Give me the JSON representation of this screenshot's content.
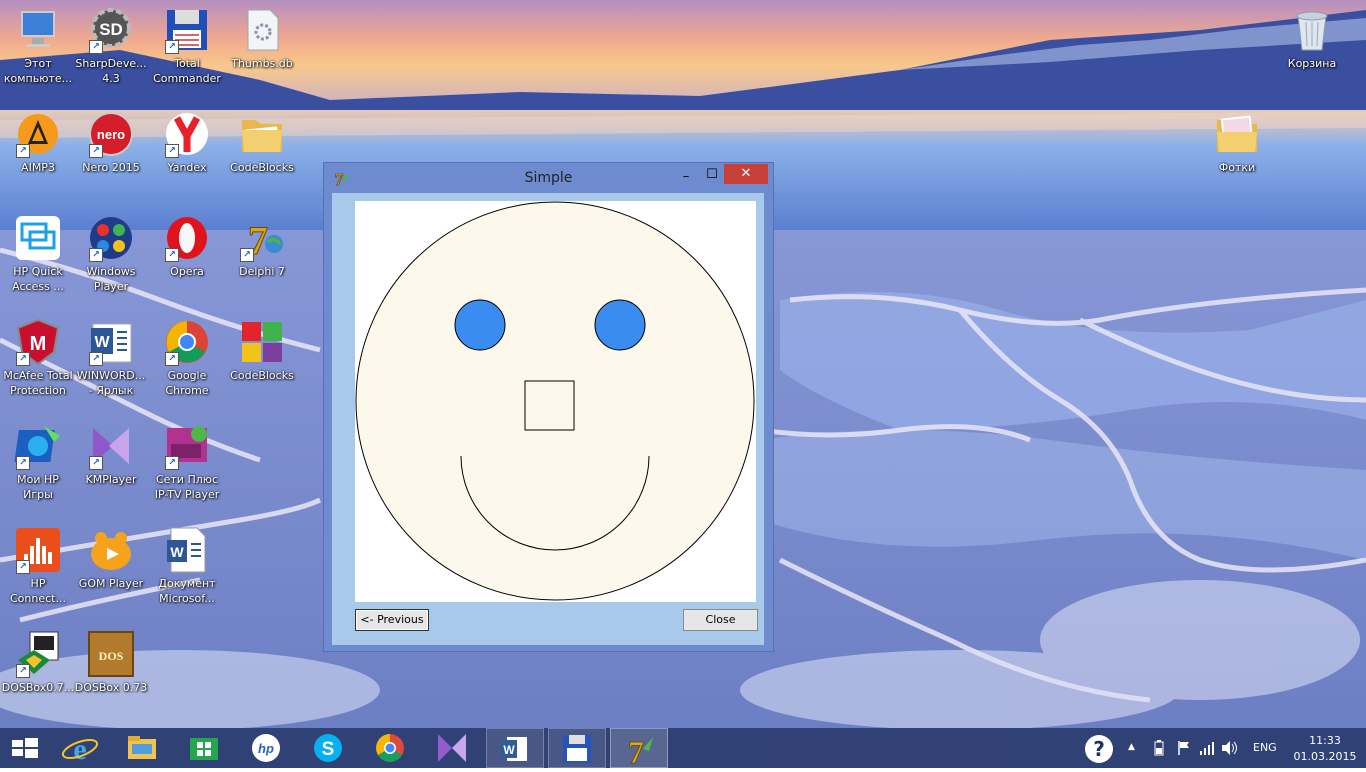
{
  "desktop_icons": {
    "computer": "Этот\nкомпьюте...",
    "sharpdevelop": "SharpDeve...\n4.3",
    "total_commander": "Total\nCommander",
    "thumbs": "Thumbs.db",
    "recycle_bin": "Корзина",
    "aimp": "AIMP3",
    "nero": "Nero 2015",
    "yandex": "Yandex",
    "codeblocks_folder": "CodeBlocks",
    "photos": "Фотки",
    "hp_quick": "HP Quick\nAccess ...",
    "windows_player": "Windows\nPlayer",
    "opera": "Opera",
    "delphi": "Delphi 7",
    "mcafee": "McAfee Total\nProtection",
    "winword": "WINWORD...\n- Ярлык",
    "chrome": "Google\nChrome",
    "codeblocks": "CodeBlocks",
    "hp_games": "Мои HP\nИгры",
    "kmplayer": "KMPlayer",
    "iptv": "Сети Плюс\nIP-TV Player",
    "hp_connect": "HP\nConnect...",
    "gom": "GOM Player",
    "document": "Документ\nMicrosof...",
    "dosbox_short": "DOSBox0.7...",
    "dosbox": "DOSBox 0.73"
  },
  "window": {
    "title": "Simple",
    "minimize": "–",
    "maximize": "☐",
    "close_glyph": "✕",
    "prev_button": "<- Previous",
    "close_button": "Close"
  },
  "drawing": {
    "face_fill": "#fdf8ec",
    "eye_fill": "#3a8cf0",
    "stroke": "#000000"
  },
  "taskbar": {
    "lang": "ENG",
    "time": "11:33",
    "date": "01.03.2015",
    "help_glyph": "?",
    "tray_arrow": "▲"
  },
  "icons": {
    "ie": "e",
    "hp": "hp",
    "skype": "S",
    "word": "W",
    "sharpdevelop": "SD",
    "nero": "nero",
    "mcafee": "M",
    "dosbox": "DOS"
  }
}
